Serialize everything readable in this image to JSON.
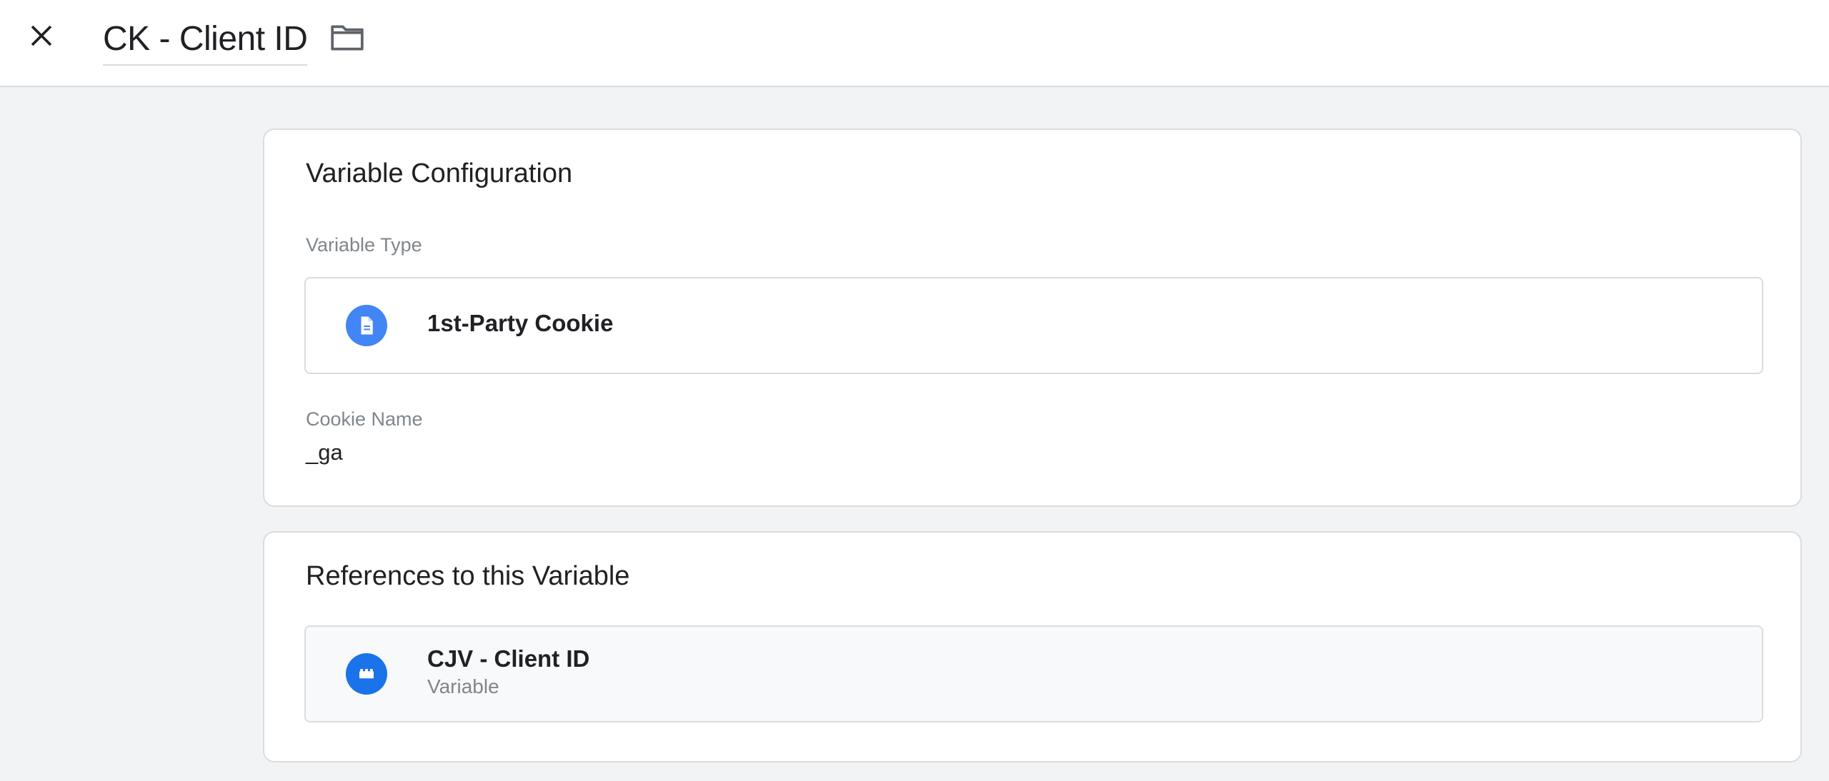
{
  "header": {
    "title": "CK - Client ID",
    "close_icon": "close-icon",
    "folder_icon": "folder-icon"
  },
  "config": {
    "title": "Variable Configuration",
    "type_label": "Variable Type",
    "type_value": "1st-Party Cookie",
    "type_icon": "document-icon",
    "cookie_label": "Cookie Name",
    "cookie_value": "_ga"
  },
  "references": {
    "title": "References to this Variable",
    "items": [
      {
        "name": "CJV - Client ID",
        "kind": "Variable",
        "icon": "variable-block-icon"
      }
    ]
  },
  "colors": {
    "accent": "#1a73e8",
    "icon_doc": "#4285f4",
    "page_bg": "#f1f3f4",
    "border": "#dadce0",
    "muted_text": "#80868b"
  }
}
